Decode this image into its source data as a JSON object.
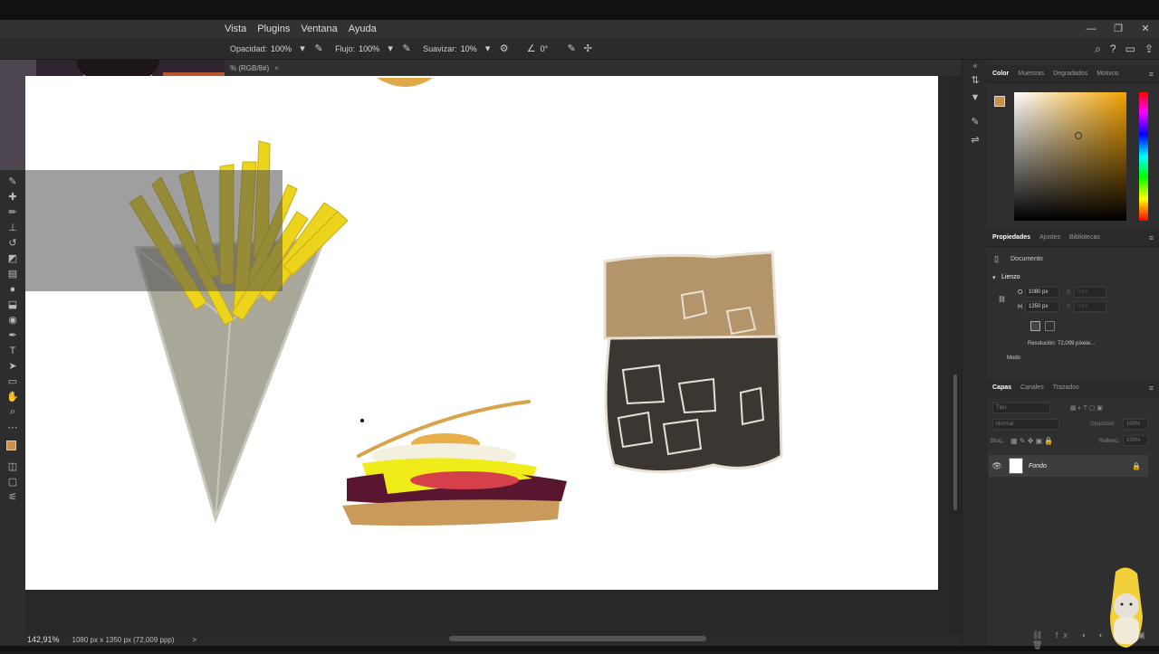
{
  "menubar": {
    "items": [
      "Vista",
      "Plugins",
      "Ventana",
      "Ayuda"
    ]
  },
  "window_controls": {
    "minimize": "—",
    "maximize": "❐",
    "close": "✕"
  },
  "options_bar": {
    "opacity_label": "Opacidad:",
    "opacity_value": "100%",
    "flow_label": "Flujo:",
    "flow_value": "100%",
    "smoothing_label": "Suavizar:",
    "smoothing_value": "10%",
    "angle_value": "0°"
  },
  "document_tab": {
    "title": "% (RGB/8#)",
    "close": "×"
  },
  "status_bar": {
    "zoom": "142,91%",
    "doc_info": "1080 px x 1350 px (72,009 ppp)",
    "arrow": ">"
  },
  "color_panel": {
    "tabs": [
      "Color",
      "Muestras",
      "Degradados",
      "Motivos"
    ],
    "active_tab": "Color",
    "foreground_color": "#c8914a",
    "background_color": "#ffffff",
    "hue_color": "#f1a100"
  },
  "properties_panel": {
    "tabs": [
      "Propiedades",
      "Ajustes",
      "Bibliotecas"
    ],
    "active_tab": "Propiedades",
    "doc_label": "Documento",
    "section": "Lienzo",
    "width_label": "O",
    "width_value": "1080 px",
    "height_label": "H",
    "height_value": "1350 px",
    "x_label": "X",
    "x_value": "0 px",
    "y_label": "Y",
    "y_value": "0 px",
    "resolution": "Resolución: 72,009 píxele...",
    "mode_label": "Modo"
  },
  "layers_panel": {
    "tabs": [
      "Capas",
      "Canales",
      "Trazados"
    ],
    "active_tab": "Capas",
    "search_placeholder": "Tipo",
    "blend_mode": "Normal",
    "opacity_label": "Opacidad:",
    "opacity_value": "100%",
    "lock_label": "Bloq.:",
    "fill_label": "Relleno:",
    "fill_value": "100%",
    "layers": [
      {
        "name": "Fondo",
        "visible": true,
        "locked": true
      }
    ]
  },
  "tools": [
    "move",
    "lasso",
    "brush",
    "stamp",
    "eraser",
    "gradient",
    "dodge",
    "pen",
    "type",
    "path-select",
    "shape",
    "hand",
    "zoom",
    "more"
  ]
}
